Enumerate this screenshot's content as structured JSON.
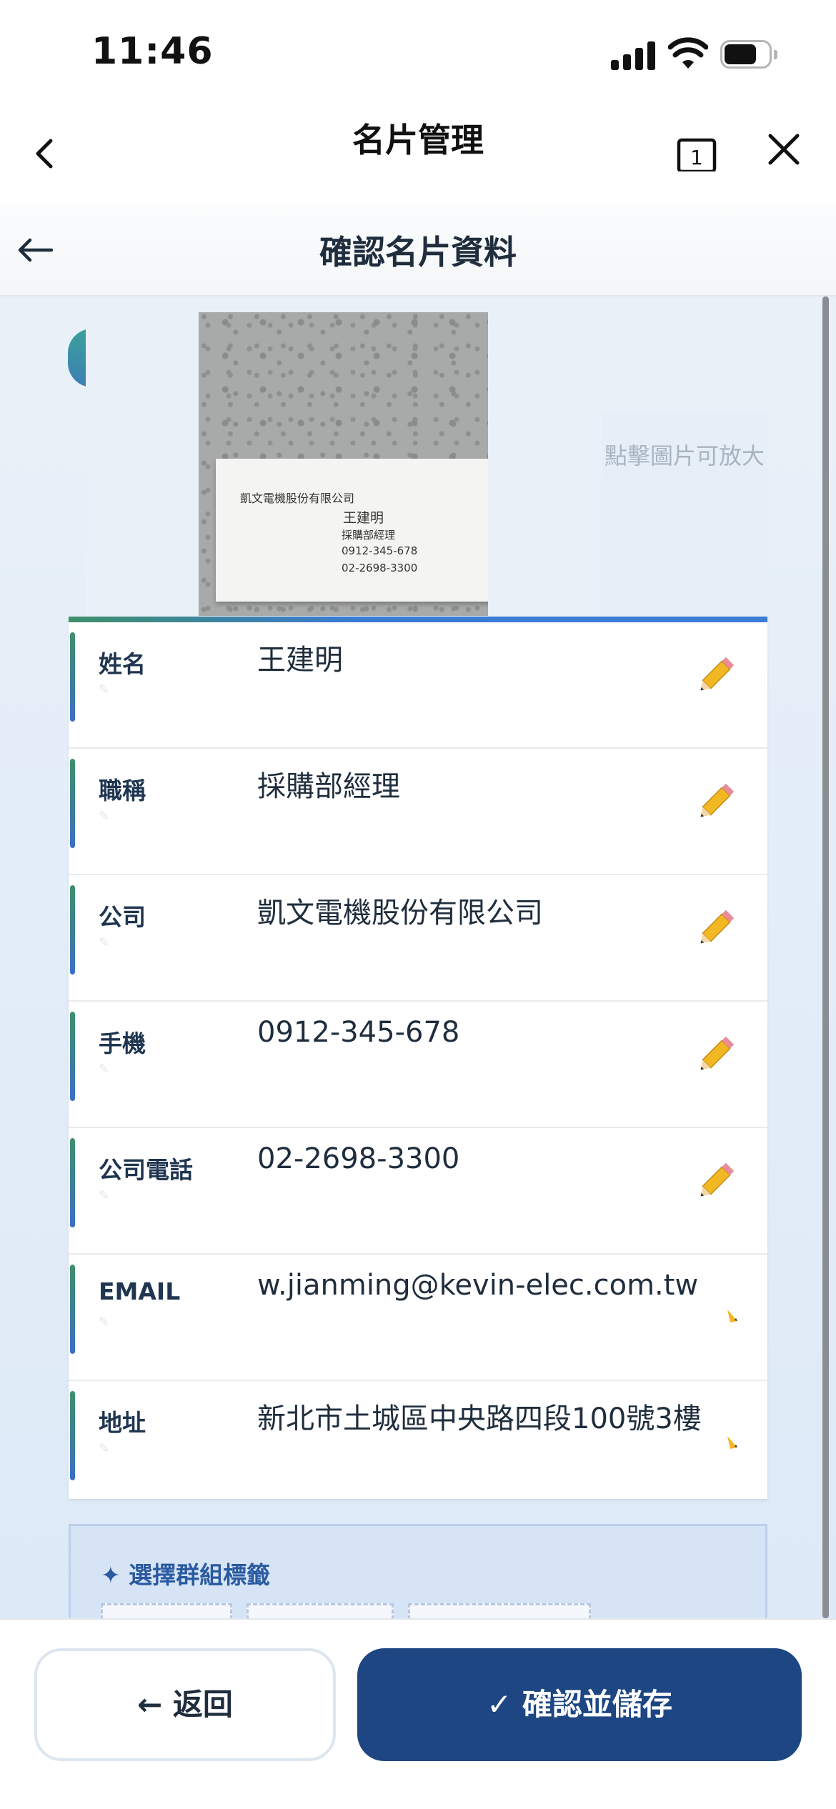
{
  "status_bar": {
    "time": "11:46"
  },
  "app_nav": {
    "title": "名片管理",
    "tab_count": "1"
  },
  "page_header": {
    "title": "確認名片資料"
  },
  "preview": {
    "zoom_hint": "點擊圖片可放大",
    "card": {
      "company": "凱文電機股份有限公司",
      "name": "王建明",
      "title": "採購部經理",
      "mobile": "0912-345-678",
      "phone": "02-2698-3300"
    }
  },
  "fields": [
    {
      "label": "姓名",
      "value": "王建明"
    },
    {
      "label": "職稱",
      "value": "採購部經理"
    },
    {
      "label": "公司",
      "value": "凱文電機股份有限公司"
    },
    {
      "label": "手機",
      "value": "0912-345-678"
    },
    {
      "label": "公司電話",
      "value": "02-2698-3300"
    },
    {
      "label": "EMAIL",
      "value": "w.jianming@kevin-elec.com.tw"
    },
    {
      "label": "地址",
      "value": "新北市土城區中央路四段100號3樓"
    }
  ],
  "groups": {
    "title": "✦ 選擇群組標籤"
  },
  "buttons": {
    "back": "← 返回",
    "save": "✓ 確認並儲存"
  },
  "icons": {
    "edit": "pencil-icon",
    "nav_back": "chevron-left-icon",
    "header_back": "arrow-left-icon",
    "close": "close-icon",
    "tabs": "tabs-icon"
  },
  "colors": {
    "primary": "#1d4683",
    "accent": "#3a7bd5",
    "teal": "#3f8f6a"
  }
}
